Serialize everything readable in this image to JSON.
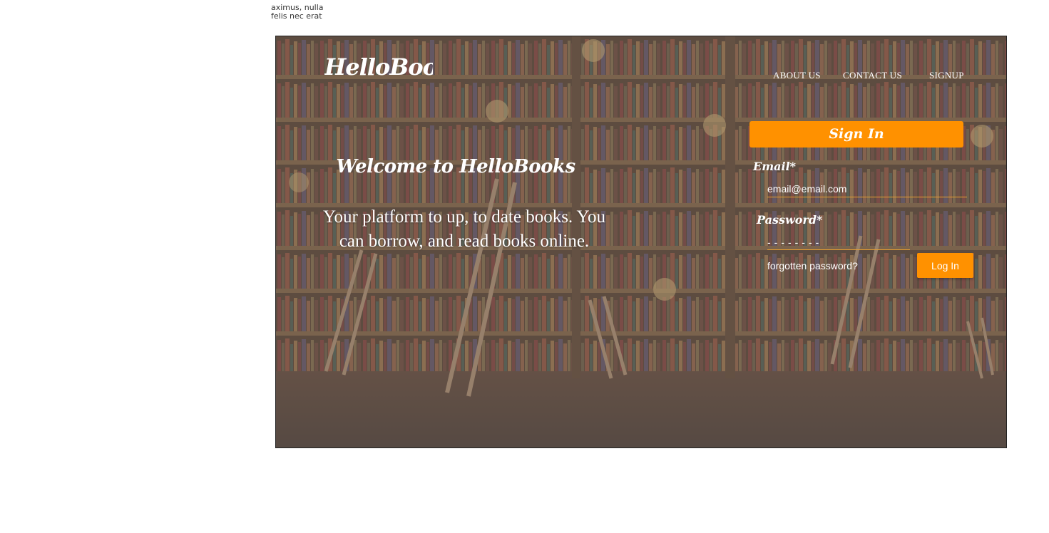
{
  "stray_text": {
    "line1": "aximus, nulla",
    "line2": "felis nec erat"
  },
  "header": {
    "brand": "HelloBooks",
    "nav": {
      "about": "ABOUT US",
      "contact": "CONTACT US",
      "signup": "SIGNUP"
    }
  },
  "hero": {
    "welcome": "Welcome to HelloBooks",
    "tagline": "Your platform to up, to date books. You can borrow, and read books online."
  },
  "signin": {
    "title": "Sign In",
    "email_label": "Email*",
    "email_placeholder": "email@email.com",
    "password_label": "Password*",
    "password_placeholder": "--------",
    "forgot_link": "forgotten password?",
    "login_button": "Log In"
  },
  "colors": {
    "accent": "#ff9100",
    "underline": "#e8a030"
  }
}
